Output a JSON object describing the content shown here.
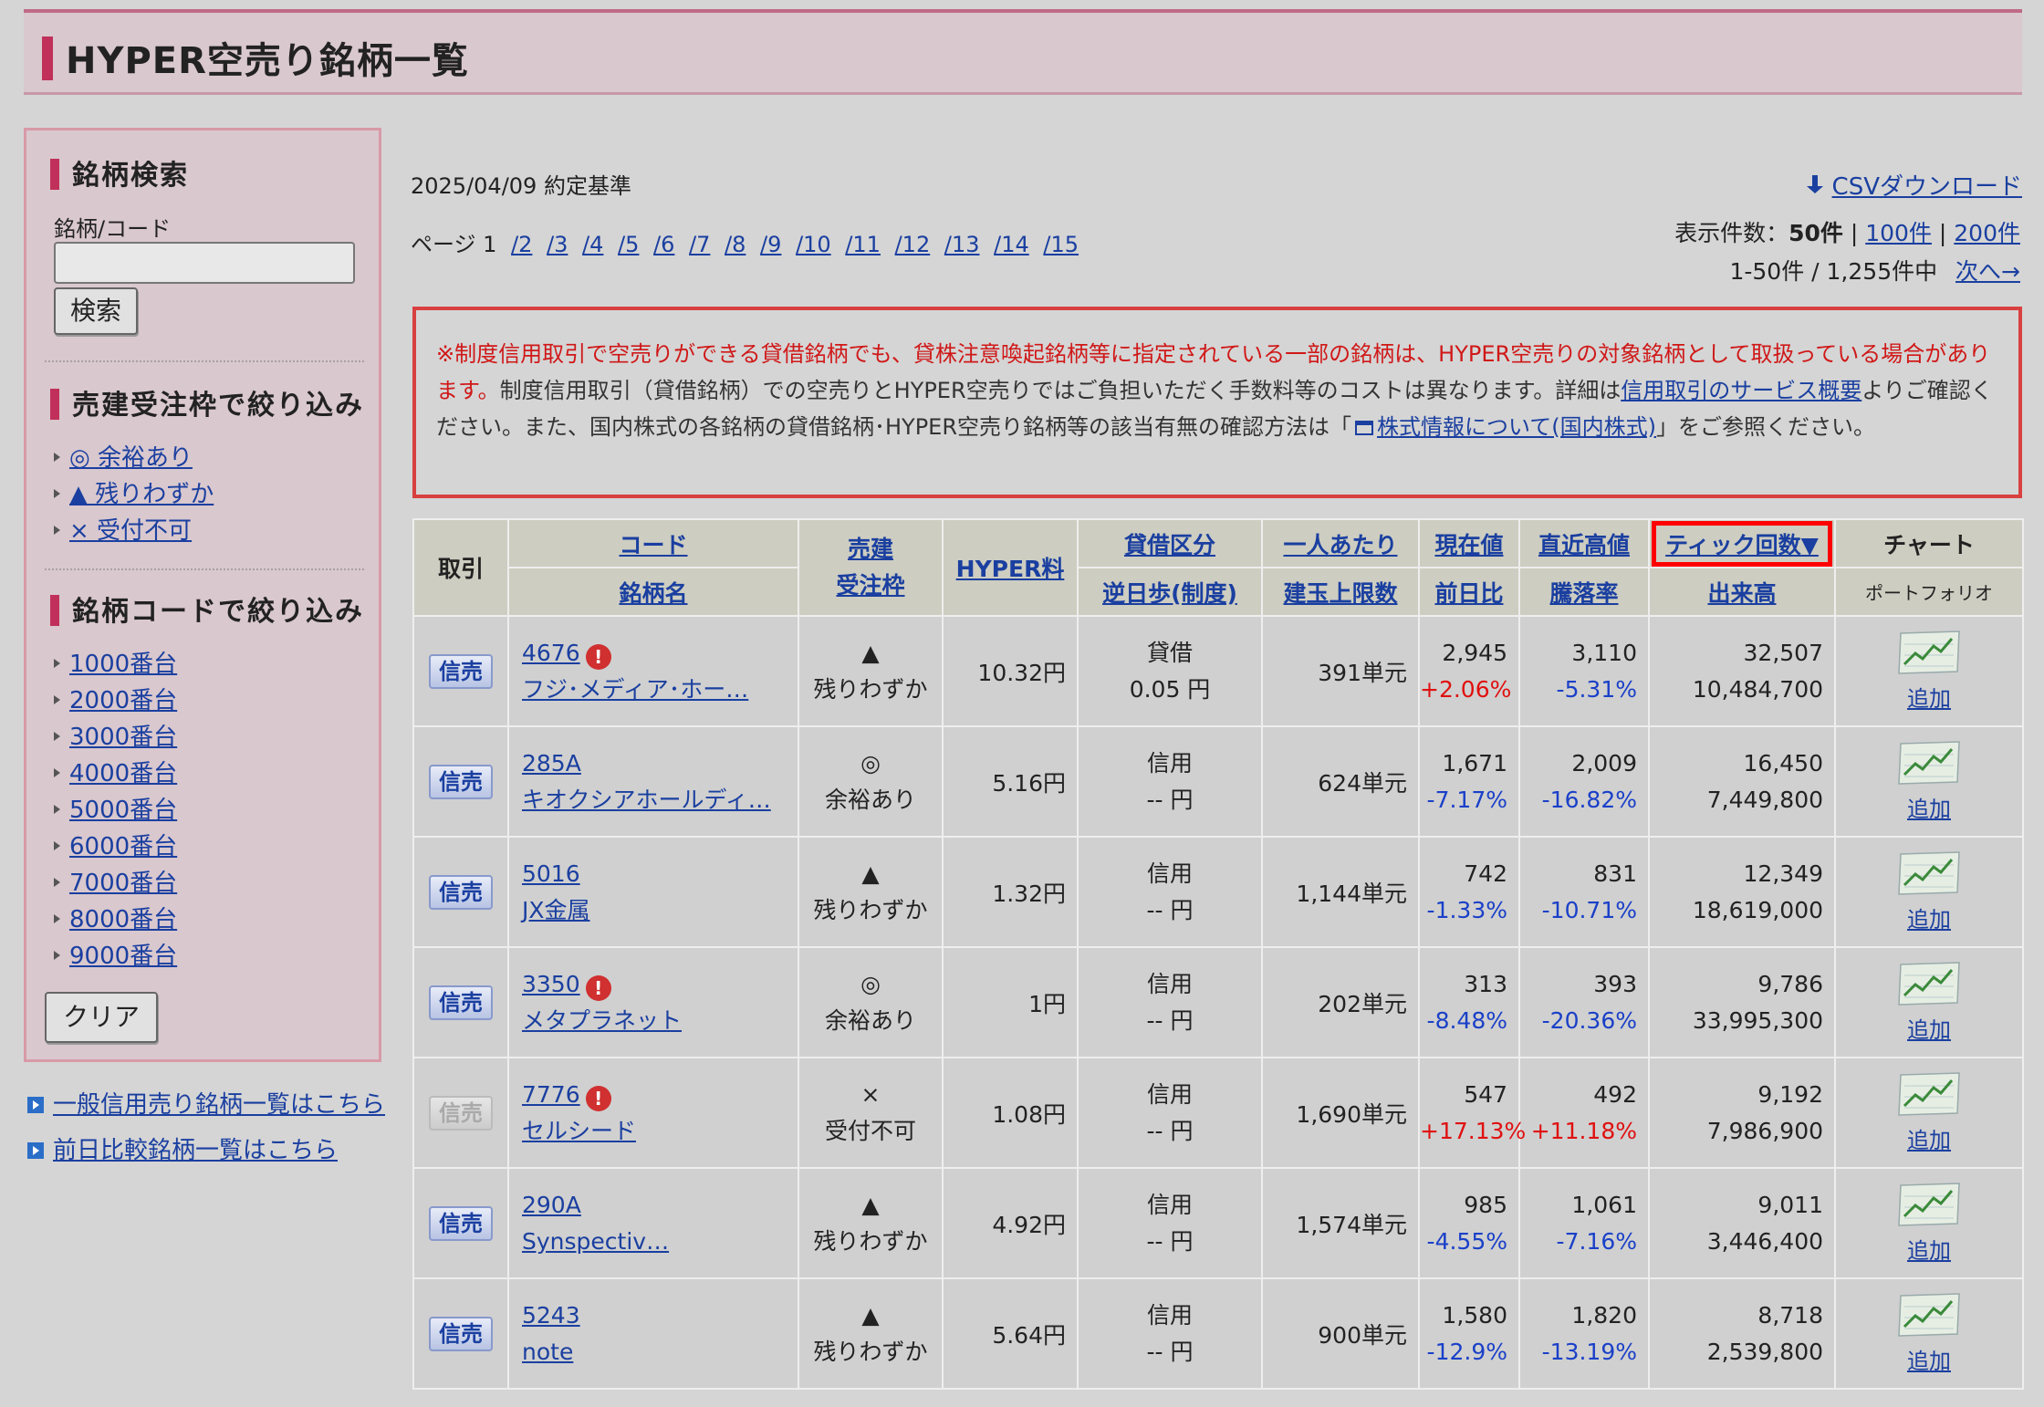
{
  "page": {
    "title": "HYPER空売り銘柄一覧"
  },
  "sidebar": {
    "search_heading": "銘柄検索",
    "code_label": "銘柄/コード",
    "code_value": "",
    "search_button": "検索",
    "order_heading": "売建受注枠で絞り込み",
    "order_filters": [
      "◎ 余裕あり",
      "▲ 残りわずか",
      "× 受付不可"
    ],
    "code_heading": "銘柄コードで絞り込み",
    "code_filters": [
      "1000番台",
      "2000番台",
      "3000番台",
      "4000番台",
      "5000番台",
      "6000番台",
      "7000番台",
      "8000番台",
      "9000番台"
    ],
    "clear_button": "クリア",
    "bottom_links": [
      "一般信用売り銘柄一覧はこちら",
      "前日比較銘柄一覧はこちら"
    ]
  },
  "top": {
    "date_text": "2025/04/09  約定基準",
    "page_label": "ページ 1",
    "pages": [
      "/2",
      "/3",
      "/4",
      "/5",
      "/6",
      "/7",
      "/8",
      "/9",
      "/10",
      "/11",
      "/12",
      "/13",
      "/14",
      "/15"
    ],
    "csv_label": "CSVダウンロード",
    "per_page_label": "表示件数：",
    "per_page_current": "50件",
    "per_page_sep": "|",
    "per_page_100": "100件",
    "per_page_200": "200件",
    "range_text": "1-50件  /  1,255件中",
    "next_label": "次へ→"
  },
  "notice": {
    "red_text": "※制度信用取引で空売りができる貸借銘柄でも、貸株注意喚起銘柄等に指定されている一部の銘柄は、HYPER空売りの対象銘柄として取扱っている場合があります。",
    "text1": "制度信用取引（貸借銘柄）での空売りとHYPER空売りではご負担いただく手数料等のコストは異なります。詳細は",
    "link1": "信用取引のサービス概要",
    "text2": "よりご確認ください。また、国内株式の各銘柄の貸借銘柄･HYPER空売り銘柄等の該当有無の確認方法は「",
    "link2": "株式情報について(国内株式)",
    "text3": "」をご参照ください。"
  },
  "table": {
    "headers": {
      "trade": "取引",
      "code": "コード",
      "name": "銘柄名",
      "sell1": "売建",
      "sell2": "受注枠",
      "hyper": "HYPER料",
      "lend": "貸借区分",
      "reverse": "逆日歩(制度)",
      "per_person1": "一人あたり",
      "per_person2": "建玉上限数",
      "price": "現在値",
      "change": "前日比",
      "recent_high": "直近高値",
      "drop_rate": "騰落率",
      "tick": "ティック回数▼",
      "volume": "出来高",
      "chart": "チャート",
      "portfolio": "ポートフォリオ"
    },
    "rows": [
      {
        "trade": "信売",
        "enabled": true,
        "code": "4676",
        "alert": true,
        "name": "フジ･メディア･ホー…",
        "mark": "▲",
        "status": "残りわずか",
        "hyper": "10.32円",
        "lend": "貸借",
        "reverse": "0.05 円",
        "limit": "391単元",
        "price": "2,945",
        "change": "+2.06%",
        "change_dir": "up",
        "high": "3,110",
        "rate": "-5.31%",
        "rate_dir": "dn",
        "tick": "32,507",
        "volume": "10,484,700",
        "add": "追加"
      },
      {
        "trade": "信売",
        "enabled": true,
        "code": "285A",
        "alert": false,
        "name": "キオクシアホールディ…",
        "mark": "◎",
        "status": "余裕あり",
        "hyper": "5.16円",
        "lend": "信用",
        "reverse": "-- 円",
        "limit": "624単元",
        "price": "1,671",
        "change": "-7.17%",
        "change_dir": "dn",
        "high": "2,009",
        "rate": "-16.82%",
        "rate_dir": "dn",
        "tick": "16,450",
        "volume": "7,449,800",
        "add": "追加"
      },
      {
        "trade": "信売",
        "enabled": true,
        "code": "5016",
        "alert": false,
        "name": "JX金属",
        "mark": "▲",
        "status": "残りわずか",
        "hyper": "1.32円",
        "lend": "信用",
        "reverse": "-- 円",
        "limit": "1,144単元",
        "price": "742",
        "change": "-1.33%",
        "change_dir": "dn",
        "high": "831",
        "rate": "-10.71%",
        "rate_dir": "dn",
        "tick": "12,349",
        "volume": "18,619,000",
        "add": "追加"
      },
      {
        "trade": "信売",
        "enabled": true,
        "code": "3350",
        "alert": true,
        "name": "メタプラネット",
        "mark": "◎",
        "status": "余裕あり",
        "hyper": "1円",
        "lend": "信用",
        "reverse": "-- 円",
        "limit": "202単元",
        "price": "313",
        "change": "-8.48%",
        "change_dir": "dn",
        "high": "393",
        "rate": "-20.36%",
        "rate_dir": "dn",
        "tick": "9,786",
        "volume": "33,995,300",
        "add": "追加"
      },
      {
        "trade": "信売",
        "enabled": false,
        "code": "7776",
        "alert": true,
        "name": "セルシード",
        "mark": "×",
        "status": "受付不可",
        "hyper": "1.08円",
        "lend": "信用",
        "reverse": "-- 円",
        "limit": "1,690単元",
        "price": "547",
        "change": "+17.13%",
        "change_dir": "up",
        "high": "492",
        "rate": "+11.18%",
        "rate_dir": "up",
        "tick": "9,192",
        "volume": "7,986,900",
        "add": "追加"
      },
      {
        "trade": "信売",
        "enabled": true,
        "code": "290A",
        "alert": false,
        "name": "Synspectiv…",
        "mark": "▲",
        "status": "残りわずか",
        "hyper": "4.92円",
        "lend": "信用",
        "reverse": "-- 円",
        "limit": "1,574単元",
        "price": "985",
        "change": "-4.55%",
        "change_dir": "dn",
        "high": "1,061",
        "rate": "-7.16%",
        "rate_dir": "dn",
        "tick": "9,011",
        "volume": "3,446,400",
        "add": "追加"
      },
      {
        "trade": "信売",
        "enabled": true,
        "code": "5243",
        "alert": false,
        "name": "note",
        "mark": "▲",
        "status": "残りわずか",
        "hyper": "5.64円",
        "lend": "信用",
        "reverse": "-- 円",
        "limit": "900単元",
        "price": "1,580",
        "change": "-12.9%",
        "change_dir": "dn",
        "high": "1,820",
        "rate": "-13.19%",
        "rate_dir": "dn",
        "tick": "8,718",
        "volume": "2,539,800",
        "add": "追加"
      }
    ]
  }
}
